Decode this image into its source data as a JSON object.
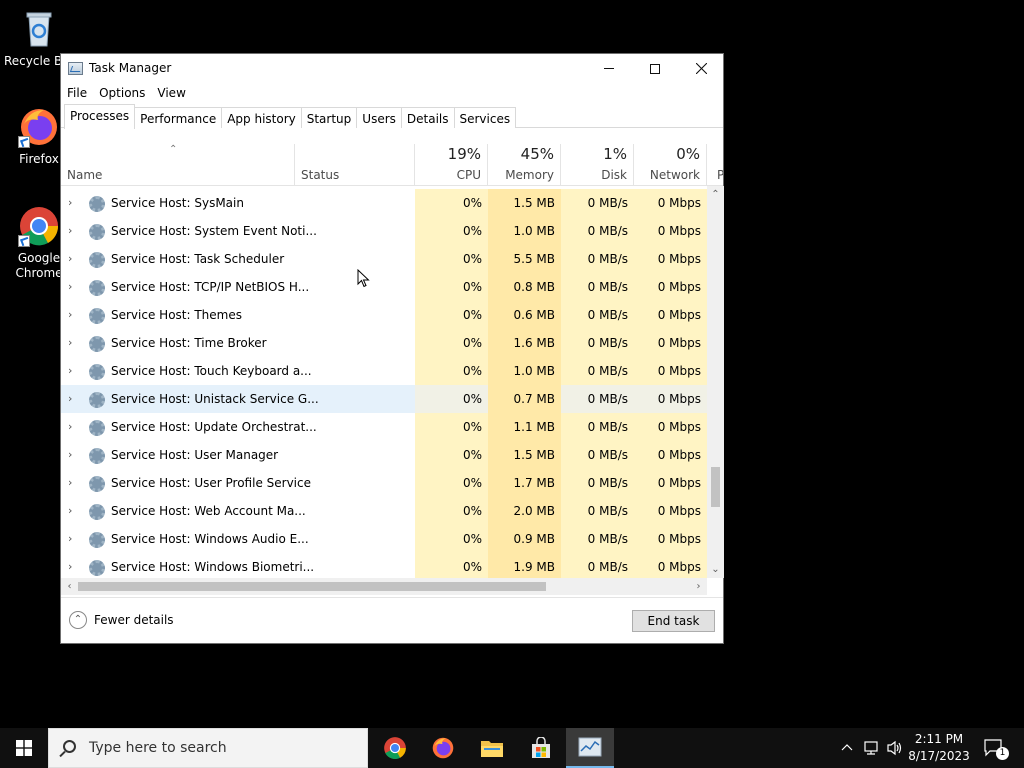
{
  "desktop": {
    "icons": [
      {
        "label": "Recycle Bin"
      },
      {
        "label": "Firefox"
      },
      {
        "label": "Google Chrome"
      }
    ]
  },
  "window": {
    "title": "Task Manager",
    "menu": [
      "File",
      "Options",
      "View"
    ],
    "tabs": [
      "Processes",
      "Performance",
      "App history",
      "Startup",
      "Users",
      "Details",
      "Services"
    ],
    "active_tab": "Processes",
    "columns": {
      "name": "Name",
      "status": "Status",
      "cpu": {
        "label": "CPU",
        "pct": "19%"
      },
      "memory": {
        "label": "Memory",
        "pct": "45%"
      },
      "disk": {
        "label": "Disk",
        "pct": "1%"
      },
      "network": {
        "label": "Network",
        "pct": "0%"
      },
      "power": "P"
    },
    "rows": [
      {
        "name": "Service Host: SysMain",
        "cpu": "0%",
        "mem": "1.5 MB",
        "disk": "0 MB/s",
        "net": "0 Mbps"
      },
      {
        "name": "Service Host: System Event Noti...",
        "cpu": "0%",
        "mem": "1.0 MB",
        "disk": "0 MB/s",
        "net": "0 Mbps"
      },
      {
        "name": "Service Host: Task Scheduler",
        "cpu": "0%",
        "mem": "5.5 MB",
        "disk": "0 MB/s",
        "net": "0 Mbps"
      },
      {
        "name": "Service Host: TCP/IP NetBIOS H...",
        "cpu": "0%",
        "mem": "0.8 MB",
        "disk": "0 MB/s",
        "net": "0 Mbps"
      },
      {
        "name": "Service Host: Themes",
        "cpu": "0%",
        "mem": "0.6 MB",
        "disk": "0 MB/s",
        "net": "0 Mbps"
      },
      {
        "name": "Service Host: Time Broker",
        "cpu": "0%",
        "mem": "1.6 MB",
        "disk": "0 MB/s",
        "net": "0 Mbps"
      },
      {
        "name": "Service Host: Touch Keyboard a...",
        "cpu": "0%",
        "mem": "1.0 MB",
        "disk": "0 MB/s",
        "net": "0 Mbps"
      },
      {
        "name": "Service Host: Unistack Service G...",
        "cpu": "0%",
        "mem": "0.7 MB",
        "disk": "0 MB/s",
        "net": "0 Mbps",
        "selected": true
      },
      {
        "name": "Service Host: Update Orchestrat...",
        "cpu": "0%",
        "mem": "1.1 MB",
        "disk": "0 MB/s",
        "net": "0 Mbps"
      },
      {
        "name": "Service Host: User Manager",
        "cpu": "0%",
        "mem": "1.5 MB",
        "disk": "0 MB/s",
        "net": "0 Mbps"
      },
      {
        "name": "Service Host: User Profile Service",
        "cpu": "0%",
        "mem": "1.7 MB",
        "disk": "0 MB/s",
        "net": "0 Mbps"
      },
      {
        "name": "Service Host: Web Account Ma...",
        "cpu": "0%",
        "mem": "2.0 MB",
        "disk": "0 MB/s",
        "net": "0 Mbps"
      },
      {
        "name": "Service Host: Windows Audio E...",
        "cpu": "0%",
        "mem": "0.9 MB",
        "disk": "0 MB/s",
        "net": "0 Mbps"
      },
      {
        "name": "Service Host: Windows Biometri...",
        "cpu": "0%",
        "mem": "1.9 MB",
        "disk": "0 MB/s",
        "net": "0 Mbps"
      }
    ],
    "footer": {
      "fewer_details": "Fewer details",
      "end_task": "End task"
    }
  },
  "taskbar": {
    "search_placeholder": "Type here to search",
    "apps": [
      "chrome-icon",
      "firefox-icon",
      "file-explorer-icon",
      "store-icon",
      "task-manager-icon"
    ],
    "time": "2:11 PM",
    "date": "8/17/2023",
    "notification_count": "1"
  }
}
